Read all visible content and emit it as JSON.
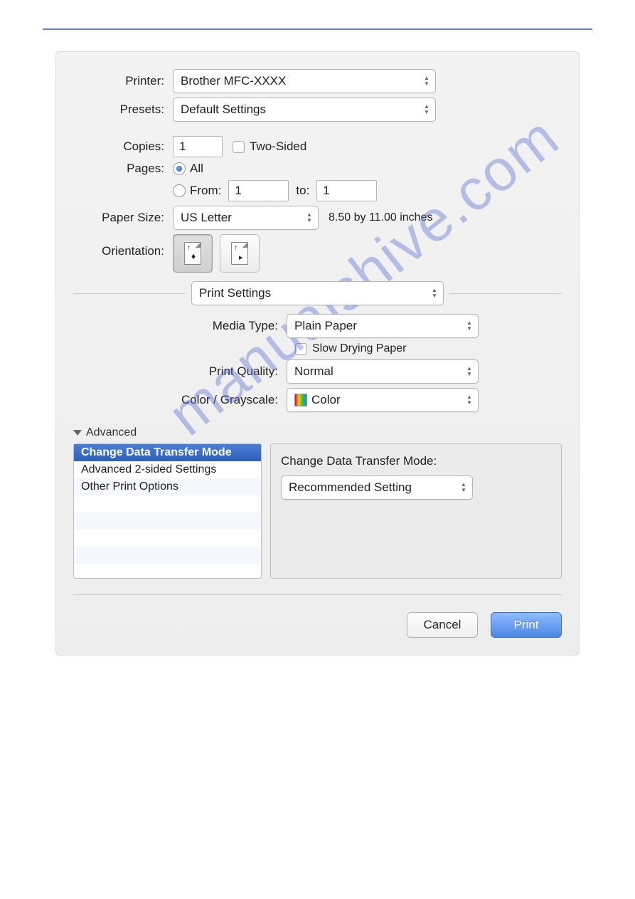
{
  "watermark": "manualshive.com",
  "labels": {
    "printer": "Printer:",
    "presets": "Presets:",
    "copies": "Copies:",
    "two_sided": "Two-Sided",
    "pages": "Pages:",
    "all": "All",
    "from": "From:",
    "to": "to:",
    "paper_size": "Paper Size:",
    "orientation": "Orientation:",
    "media_type": "Media Type:",
    "slow_drying": "Slow Drying Paper",
    "print_quality": "Print Quality:",
    "color_grayscale": "Color / Grayscale:",
    "advanced": "Advanced",
    "change_mode": "Change Data Transfer Mode:",
    "cancel": "Cancel",
    "print": "Print"
  },
  "values": {
    "printer": "Brother MFC-XXXX",
    "presets": "Default Settings",
    "copies": "1",
    "from": "1",
    "to": "1",
    "paper_size": "US Letter",
    "paper_dims": "8.50 by 11.00 inches",
    "section": "Print Settings",
    "media_type": "Plain Paper",
    "print_quality": "Normal",
    "color": "Color",
    "adv_mode": "Recommended Setting"
  },
  "advanced_list": [
    "Change Data Transfer Mode",
    "Advanced 2-sided Settings",
    "Other Print Options"
  ]
}
